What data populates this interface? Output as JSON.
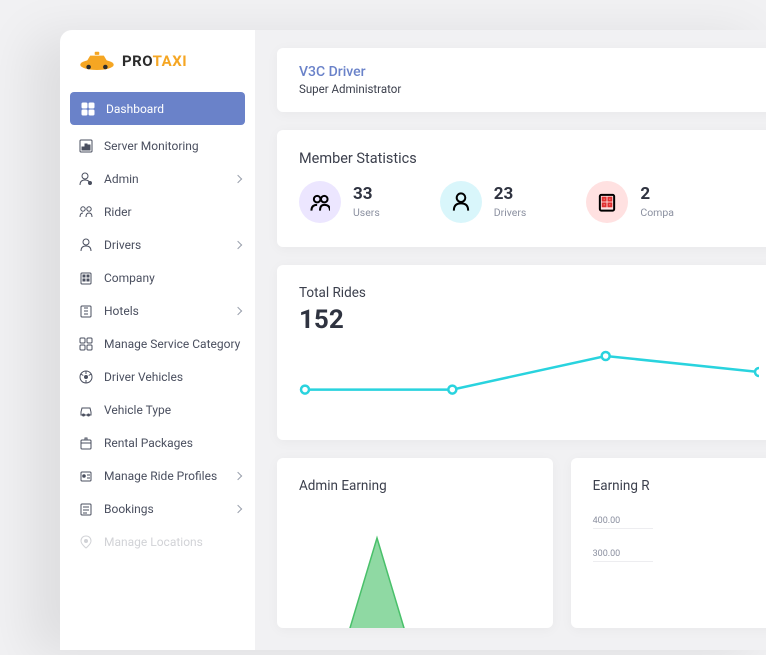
{
  "brand": {
    "pro": "PRO",
    "taxi": "TAXI"
  },
  "sidebar": {
    "items": [
      {
        "label": "Dashboard",
        "icon": "grid",
        "active": true,
        "expand": false
      },
      {
        "label": "Server Monitoring",
        "icon": "chart",
        "expand": false
      },
      {
        "label": "Admin",
        "icon": "admin",
        "expand": true
      },
      {
        "label": "Rider",
        "icon": "riders",
        "expand": false
      },
      {
        "label": "Drivers",
        "icon": "driver",
        "expand": true
      },
      {
        "label": "Company",
        "icon": "company",
        "expand": false
      },
      {
        "label": "Hotels",
        "icon": "hotel",
        "expand": true
      },
      {
        "label": "Manage Service Category",
        "icon": "cats",
        "expand": false
      },
      {
        "label": "Driver Vehicles",
        "icon": "wheel",
        "expand": false
      },
      {
        "label": "Vehicle Type",
        "icon": "car",
        "expand": false
      },
      {
        "label": "Rental Packages",
        "icon": "box",
        "expand": false
      },
      {
        "label": "Manage Ride Profiles",
        "icon": "profile",
        "expand": true
      },
      {
        "label": "Bookings",
        "icon": "list",
        "expand": true
      },
      {
        "label": "Manage Locations",
        "icon": "pin",
        "expand": false,
        "faded": true
      }
    ]
  },
  "header": {
    "title": "V3C Driver",
    "subtitle": "Super Administrator"
  },
  "stats": {
    "title": "Member Statistics",
    "items": [
      {
        "value": "33",
        "label": "Users",
        "bubble": "lav",
        "icon": "users"
      },
      {
        "value": "23",
        "label": "Drivers",
        "bubble": "cyan",
        "icon": "driver"
      },
      {
        "value": "2",
        "label": "Compa",
        "bubble": "pink",
        "icon": "company"
      }
    ]
  },
  "rides": {
    "title": "Total Rides",
    "value": "152"
  },
  "earnLeft": {
    "title": "Admin Earning"
  },
  "earnRight": {
    "title": "Earning R",
    "axis": [
      "400.00",
      "300.00"
    ]
  },
  "chart_data": [
    {
      "type": "line",
      "title": "Total Rides",
      "x": [
        0,
        1,
        2,
        3
      ],
      "values": [
        38,
        38,
        80,
        60
      ],
      "color": "#29d3de",
      "ylim": [
        0,
        100
      ]
    },
    {
      "type": "area",
      "title": "Admin Earning",
      "x": [
        0,
        1,
        2
      ],
      "values": [
        0,
        100,
        0
      ],
      "color": "#49c06a"
    },
    {
      "type": "bar",
      "title": "Earning R",
      "ylabel": "",
      "yticks": [
        300.0,
        400.0
      ],
      "series": []
    }
  ]
}
